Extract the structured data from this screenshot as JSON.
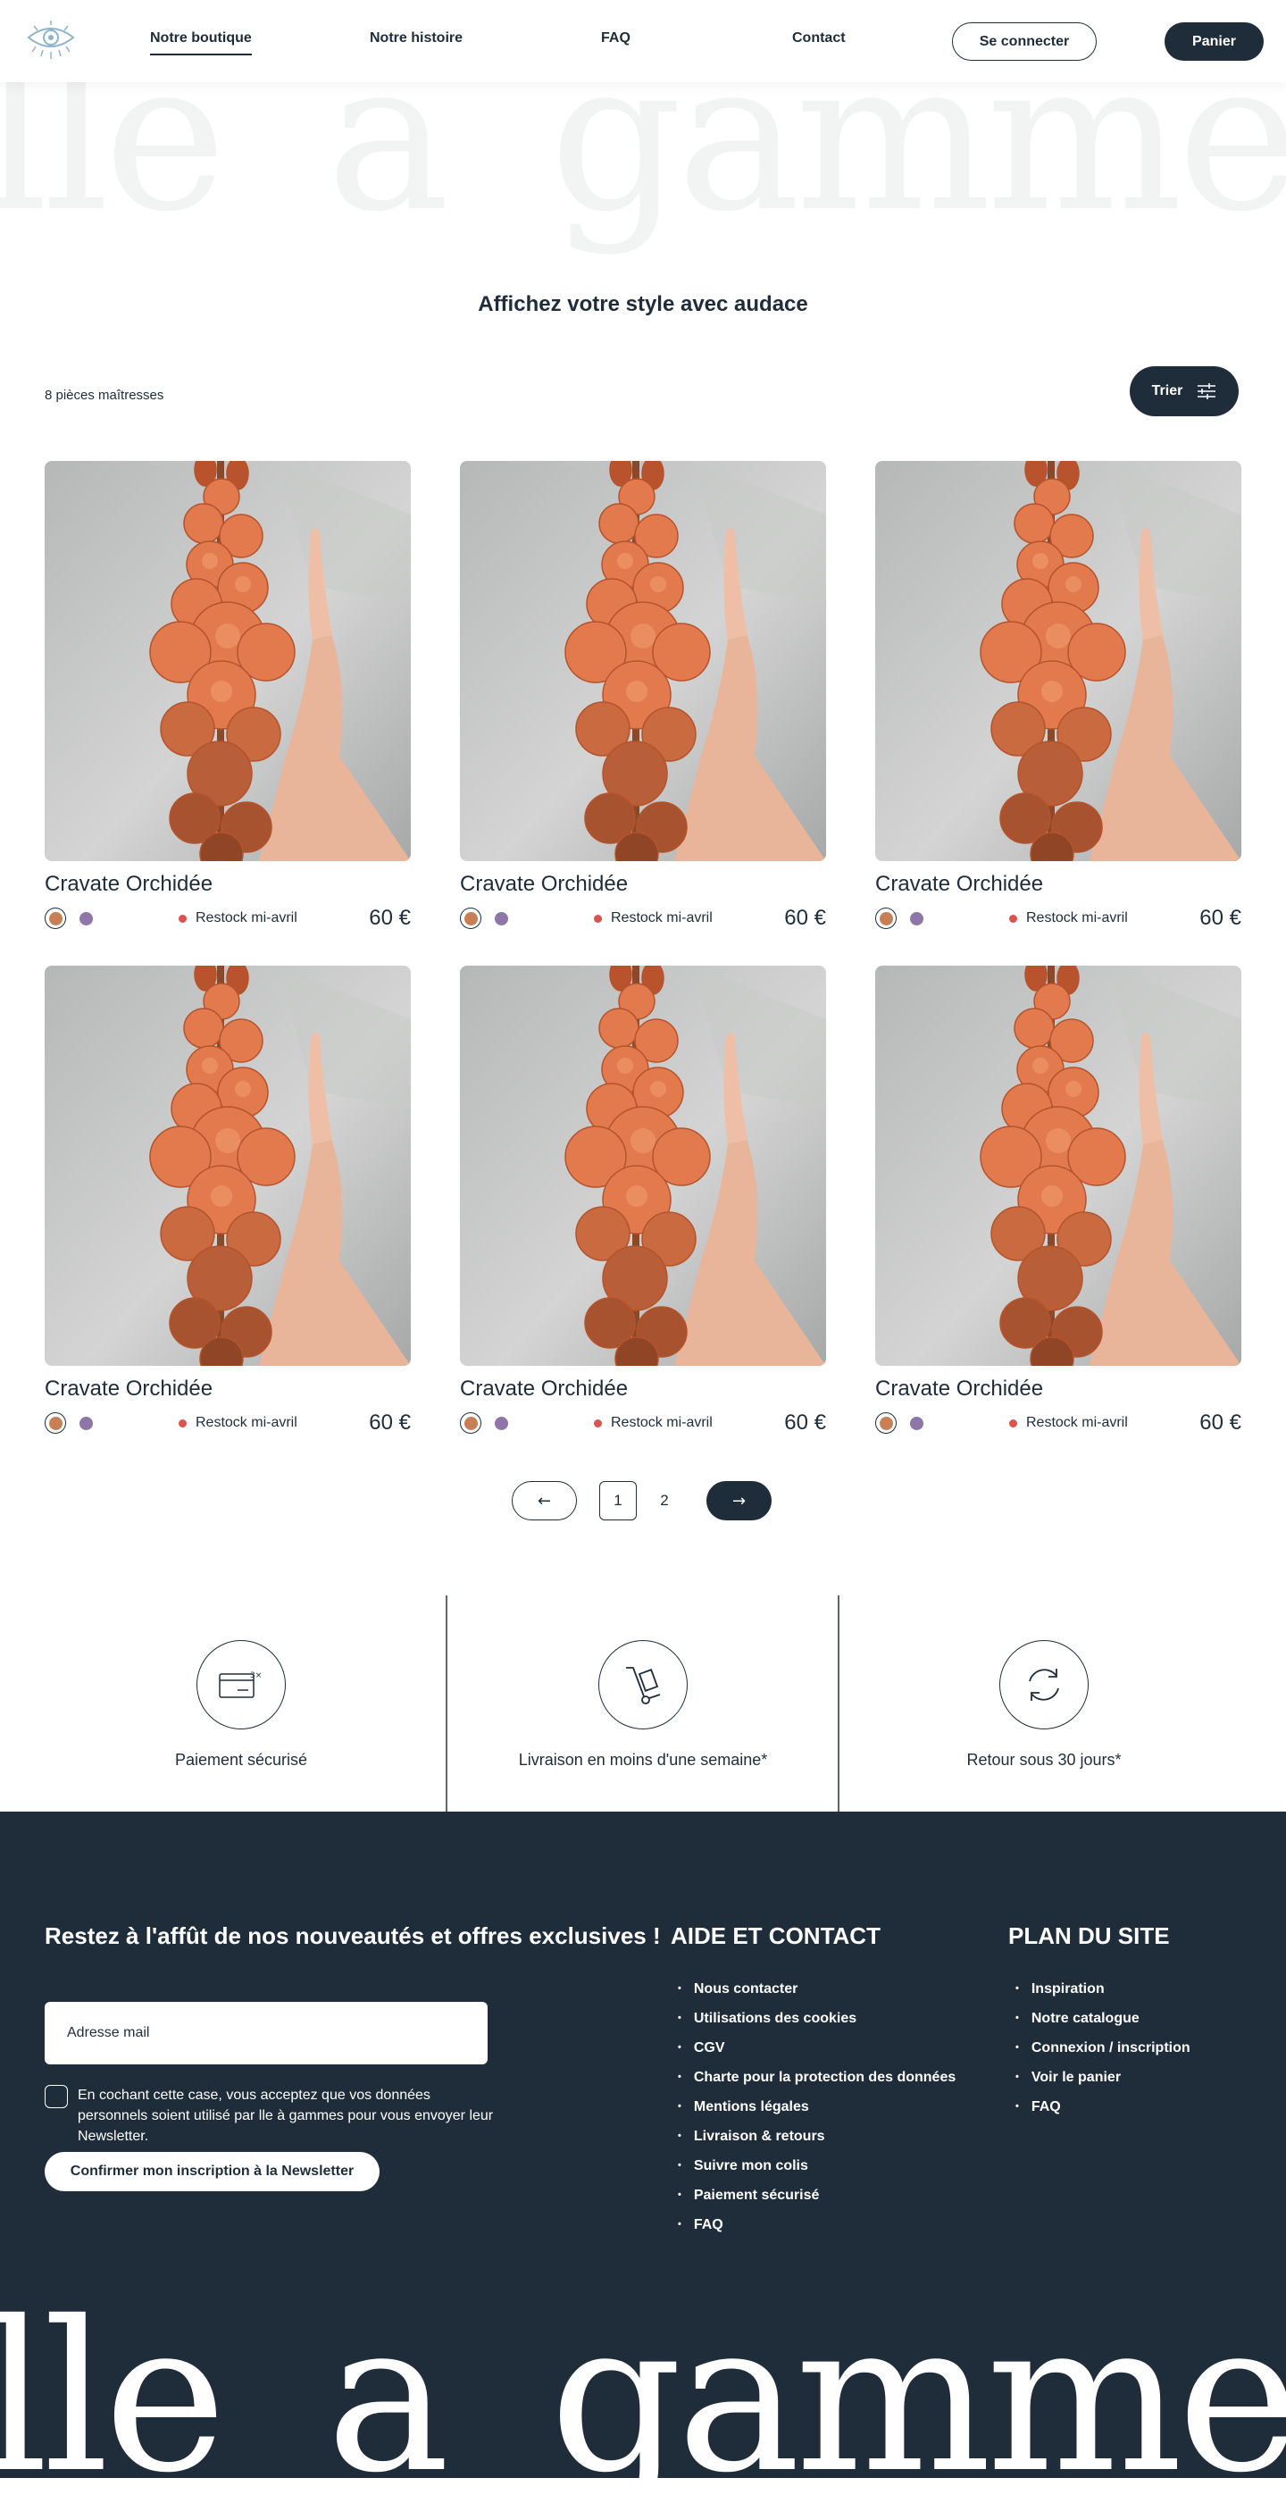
{
  "header": {
    "nav": [
      "Notre boutique",
      "Notre histoire",
      "FAQ",
      "Contact"
    ],
    "login_label": "Se connecter",
    "cart_label": "Panier",
    "logo_icon": "eye-logo-icon"
  },
  "hero": {
    "watermark": "lle a gammes",
    "tagline": "Affichez votre style avec audace"
  },
  "listing": {
    "count_label": "8 pièces maîtresses",
    "sort_label": "Trier",
    "sort_icon": "sliders-icon"
  },
  "products": [
    {
      "name": "Cravate Orchidée",
      "stock": "Restock mi-avril",
      "price": "60 €"
    },
    {
      "name": "Cravate Orchidée",
      "stock": "Restock mi-avril",
      "price": "60 €"
    },
    {
      "name": "Cravate Orchidée",
      "stock": "Restock mi-avril",
      "price": "60 €"
    },
    {
      "name": "Cravate Orchidée",
      "stock": "Restock mi-avril",
      "price": "60 €"
    },
    {
      "name": "Cravate Orchidée",
      "stock": "Restock mi-avril",
      "price": "60 €"
    },
    {
      "name": "Cravate Orchidée",
      "stock": "Restock mi-avril",
      "price": "60 €"
    }
  ],
  "colors": {
    "brand": "#1f2d3a",
    "swatch_orange": "#c97f55",
    "swatch_purple": "#8e76a8",
    "stock_dot": "#d9534f"
  },
  "pagination": {
    "prev": "←",
    "pages": [
      "1",
      "2"
    ],
    "current_page": "1",
    "next": "→"
  },
  "features": [
    {
      "label": "Paiement sécurisé",
      "icon": "card-payment-icon"
    },
    {
      "label": "Livraison en moins d'une semaine*",
      "icon": "hand-truck-icon"
    },
    {
      "label": "Retour sous 30 jours*",
      "icon": "refresh-arrows-icon"
    }
  ],
  "footer": {
    "newsletter_title": "Restez à l'affût de nos nouveautés et offres exclusives !",
    "email_placeholder": "Adresse mail",
    "consent_text": "En cochant cette case, vous acceptez que vos données personnels soient utilisé par lle à gammes pour vous envoyer leur Newsletter.",
    "submit_label": "Confirmer mon inscription à la Newsletter",
    "help_title": "AIDE ET CONTACT",
    "help_links": [
      "Nous contacter",
      "Utilisations des cookies",
      "CGV",
      "Charte pour la protection des données",
      "Mentions légales",
      "Livraison & retours",
      "Suivre mon colis",
      "Paiement sécurisé",
      "FAQ"
    ],
    "sitemap_title": "PLAN DU SITE",
    "sitemap_links": [
      "Inspiration",
      "Notre catalogue",
      "Connexion / inscription",
      "Voir le panier",
      "FAQ"
    ],
    "watermark": "lle a gammes"
  }
}
